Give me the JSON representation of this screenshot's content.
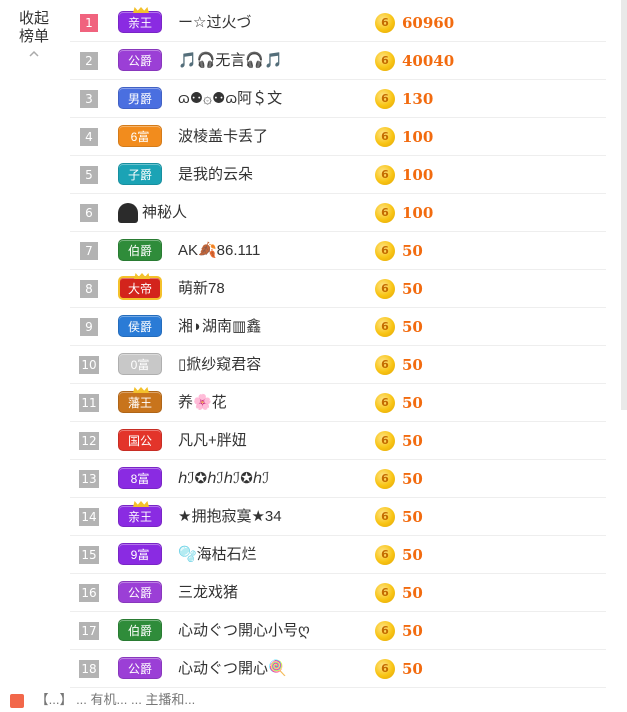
{
  "sidebar": {
    "collapse_label": "收起榜单"
  },
  "colors": {
    "rank_top1": "#f0637e",
    "rank_default": "#b3b3b3",
    "amount": "#f26b0f",
    "coin": "#f8c414"
  },
  "rank_list": [
    {
      "rank": "1",
      "badge": "亲王",
      "badge_color": "#8a2be2",
      "name": "ー☆过火づ",
      "coin": "6",
      "amount": "60960"
    },
    {
      "rank": "2",
      "badge": "公爵",
      "badge_color": "#9b3fd6",
      "name": "🎵🎧无言🎧🎵",
      "coin": "6",
      "amount": "40040"
    },
    {
      "rank": "3",
      "badge": "男爵",
      "badge_color": "#4a6fe0",
      "name": "ɷ⚉۞⚉ɷ阿＄文",
      "coin": "6",
      "amount": "130"
    },
    {
      "rank": "4",
      "badge": "6富",
      "badge_color": "#f28c1d",
      "name": "波棱盖卡丢了",
      "coin": "6",
      "amount": "100"
    },
    {
      "rank": "5",
      "badge": "子爵",
      "badge_color": "#1ba3b5",
      "name": "是我的云朵",
      "coin": "6",
      "amount": "100"
    },
    {
      "rank": "6",
      "badge": "",
      "badge_color": "#2b2b2b",
      "name": "神秘人",
      "coin": "6",
      "amount": "100"
    },
    {
      "rank": "7",
      "badge": "伯爵",
      "badge_color": "#2f8c3a",
      "name": "AK🍂86.111",
      "coin": "6",
      "amount": "50"
    },
    {
      "rank": "8",
      "badge": "大帝",
      "badge_color": "#d3241c",
      "name": "萌新78",
      "coin": "6",
      "amount": "50"
    },
    {
      "rank": "9",
      "badge": "侯爵",
      "badge_color": "#2a7bd6",
      "name": "湘◗湖南▥鑫",
      "coin": "6",
      "amount": "50"
    },
    {
      "rank": "10",
      "badge": "0富",
      "badge_color": "#c8c8c8",
      "name": "▯掀纱窥君容",
      "coin": "6",
      "amount": "50"
    },
    {
      "rank": "11",
      "badge": "藩王",
      "badge_color": "#c8741c",
      "name": "养🌸花",
      "coin": "6",
      "amount": "50"
    },
    {
      "rank": "12",
      "badge": "国公",
      "badge_color": "#e3342a",
      "name": "凡凡+胖妞",
      "coin": "6",
      "amount": "50"
    },
    {
      "rank": "13",
      "badge": "8富",
      "badge_color": "#8a2be2",
      "name": "ℎℐ✪ℎℐℎℐ✪ℎℐ",
      "coin": "6",
      "amount": "50"
    },
    {
      "rank": "14",
      "badge": "亲王",
      "badge_color": "#8a2be2",
      "name": "★拥抱寂寞★34",
      "coin": "6",
      "amount": "50"
    },
    {
      "rank": "15",
      "badge": "9富",
      "badge_color": "#8a2be2",
      "name": "🫧海枯石烂",
      "coin": "6",
      "amount": "50"
    },
    {
      "rank": "16",
      "badge": "公爵",
      "badge_color": "#9b3fd6",
      "name": "三龙戏猪",
      "coin": "6",
      "amount": "50"
    },
    {
      "rank": "17",
      "badge": "伯爵",
      "badge_color": "#2f8c3a",
      "name": "心动ぐつ開心小号ღ",
      "coin": "6",
      "amount": "50"
    },
    {
      "rank": "18",
      "badge": "公爵",
      "badge_color": "#9b3fd6",
      "name": "心动ぐつ開心🍭",
      "coin": "6",
      "amount": "50"
    }
  ],
  "bottom_bar": {
    "text": "【...】 ... 有机... ... 主播和..."
  }
}
